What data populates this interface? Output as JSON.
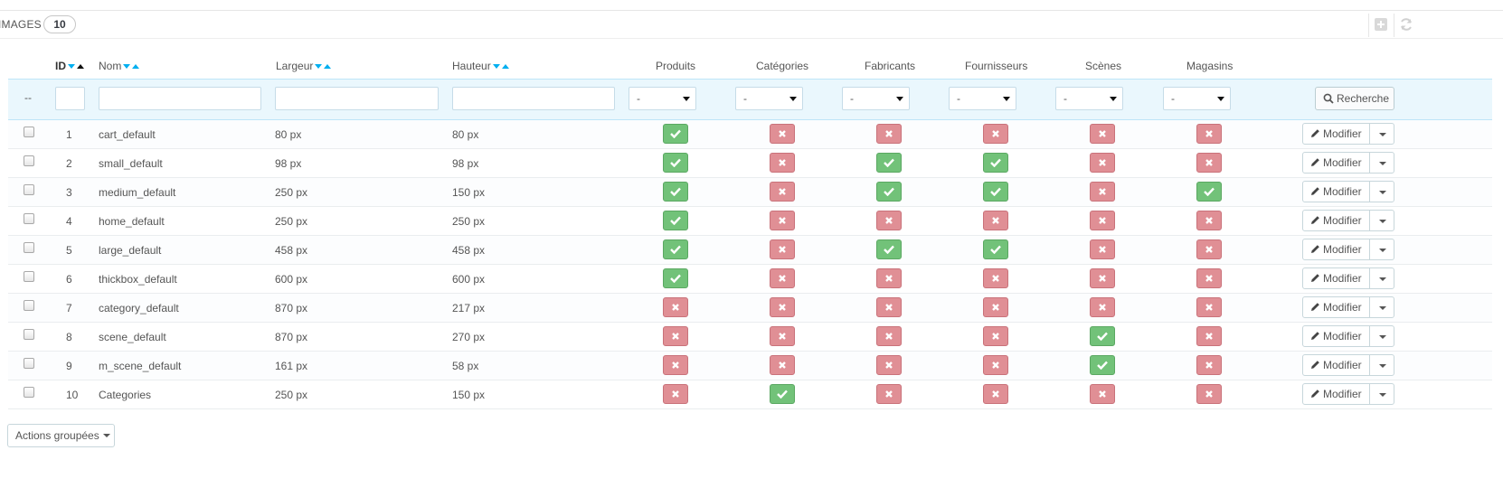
{
  "heading": {
    "title": "IMAGES",
    "count": "10"
  },
  "toolbar": {
    "add_icon": "plus-square-icon",
    "refresh_icon": "refresh-icon"
  },
  "columns": {
    "id": "ID",
    "nom": "Nom",
    "largeur": "Largeur",
    "hauteur": "Hauteur",
    "produits": "Produits",
    "categories": "Catégories",
    "fabricants": "Fabricants",
    "fournisseurs": "Fournisseurs",
    "scenes": "Scènes",
    "magasins": "Magasins"
  },
  "filters": {
    "placeholder_dash": "--",
    "select_value": "-",
    "search_label": "Recherche"
  },
  "rows": [
    {
      "id": "1",
      "name": "cart_default",
      "width": "80 px",
      "height": "80 px",
      "flags": [
        true,
        false,
        false,
        false,
        false,
        false
      ]
    },
    {
      "id": "2",
      "name": "small_default",
      "width": "98 px",
      "height": "98 px",
      "flags": [
        true,
        false,
        true,
        true,
        false,
        false
      ]
    },
    {
      "id": "3",
      "name": "medium_default",
      "width": "250 px",
      "height": "150 px",
      "flags": [
        true,
        false,
        true,
        true,
        false,
        true
      ]
    },
    {
      "id": "4",
      "name": "home_default",
      "width": "250 px",
      "height": "250 px",
      "flags": [
        true,
        false,
        false,
        false,
        false,
        false
      ]
    },
    {
      "id": "5",
      "name": "large_default",
      "width": "458 px",
      "height": "458 px",
      "flags": [
        true,
        false,
        true,
        true,
        false,
        false
      ]
    },
    {
      "id": "6",
      "name": "thickbox_default",
      "width": "600 px",
      "height": "600 px",
      "flags": [
        true,
        false,
        false,
        false,
        false,
        false
      ]
    },
    {
      "id": "7",
      "name": "category_default",
      "width": "870 px",
      "height": "217 px",
      "flags": [
        false,
        false,
        false,
        false,
        false,
        false
      ]
    },
    {
      "id": "8",
      "name": "scene_default",
      "width": "870 px",
      "height": "270 px",
      "flags": [
        false,
        false,
        false,
        false,
        true,
        false
      ]
    },
    {
      "id": "9",
      "name": "m_scene_default",
      "width": "161 px",
      "height": "58 px",
      "flags": [
        false,
        false,
        false,
        false,
        true,
        false
      ]
    },
    {
      "id": "10",
      "name": "Categories",
      "width": "250 px",
      "height": "150 px",
      "flags": [
        false,
        true,
        false,
        false,
        false,
        false
      ]
    }
  ],
  "row_action": {
    "edit_label": "Modifier"
  },
  "bulk": {
    "label": "Actions groupées"
  },
  "colors": {
    "yes": "#72c279",
    "no": "#e08f95",
    "sort_active": "#00aff0",
    "filter_bg": "#eaf7fd"
  }
}
